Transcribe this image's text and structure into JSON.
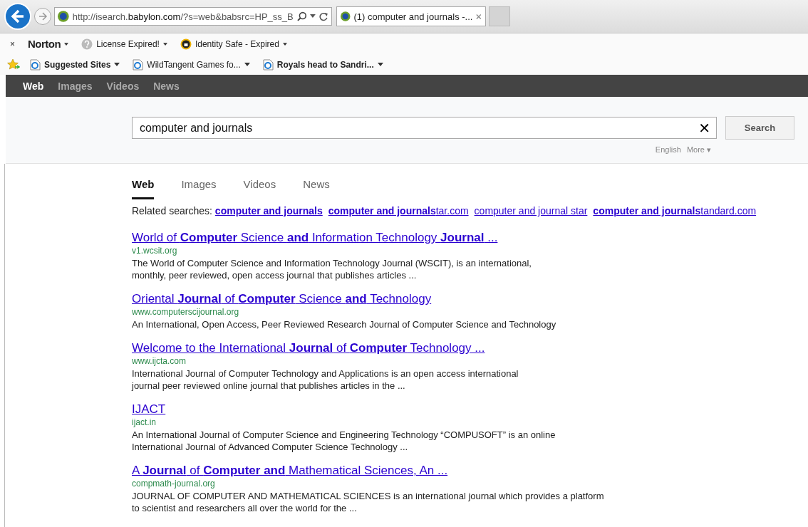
{
  "browser": {
    "address": "http://isearch.**babylon.com**/?s=web&babsrc=HP_ss_B",
    "tabs": [
      {
        "title": "(1) computer and journals -...",
        "selected": true
      }
    ]
  },
  "norton_bar": {
    "close": "×",
    "brand": "Norton",
    "items": [
      {
        "label": "License Expired!"
      },
      {
        "label": "Identity Safe - Expired"
      }
    ]
  },
  "favorites_bar": {
    "items": [
      {
        "label": "Suggested Sites",
        "bold": true
      },
      {
        "label": "WildTangent Games fo...",
        "bold": false
      },
      {
        "label": "Royals head to Sandri...",
        "bold": true
      }
    ]
  },
  "top_nav": [
    {
      "label": "Web",
      "selected": true
    },
    {
      "label": "Images",
      "selected": false
    },
    {
      "label": "Videos",
      "selected": false
    },
    {
      "label": "News",
      "selected": false
    }
  ],
  "search": {
    "value": "computer and journals",
    "clear": "✕",
    "button": "Search",
    "language": "English",
    "more": "More ▾"
  },
  "result_tabs": [
    {
      "label": "Web",
      "selected": true
    },
    {
      "label": "Images",
      "selected": false
    },
    {
      "label": "Videos",
      "selected": false
    },
    {
      "label": "News",
      "selected": false
    }
  ],
  "related": {
    "label": "Related searches:",
    "links": [
      "**computer and journals**",
      "**computer and journals**tar.com",
      "computer and journal star",
      "**computer and journals**tandard.com"
    ]
  },
  "results": [
    {
      "title": "World of **Computer** Science **and** Information Technology **Journal** ...",
      "url": "v1.wcsit.org",
      "lines": [
        "The World of Computer Science and Information Technology Journal (WSCIT), is an international,",
        "monthly, peer reviewed, open access journal that publishes articles ..."
      ]
    },
    {
      "title": "Oriental **Journal** of **Computer** Science **and** Technology",
      "url": "www.computerscijournal.org",
      "lines": [
        "An International, Open Access, Peer Reviewed Research Journal of Computer Science and Technology"
      ]
    },
    {
      "title": "Welcome to the International **Journal** of **Computer** Technology ...",
      "url": "www.ijcta.com",
      "lines": [
        "International Journal of Computer Technology and Applications is an open access international",
        "journal peer reviewed online journal that publishes articles in the ..."
      ]
    },
    {
      "title": "IJACT",
      "url": "ijact.in",
      "lines": [
        "An International Journal of Computer Science and Engineering Technology “COMPUSOFT” is an online",
        "International Journal of Advanced Computer Science Technology ..."
      ]
    },
    {
      "title": "A **Journal** of **Computer and** Mathematical Sciences, An ...",
      "url": "compmath-journal.org",
      "lines": [
        "JOURNAL OF COMPUTER AND MATHEMATICAL SCIENCES is an international journal which provides a platform",
        "to scientist and researchers all over the world for the ..."
      ]
    }
  ]
}
